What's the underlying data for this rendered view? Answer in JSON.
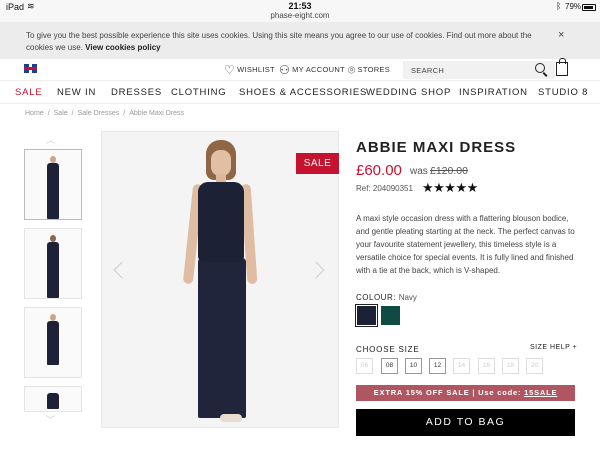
{
  "status_bar": {
    "carrier": "iPad",
    "time": "21:53",
    "url": "phase-eight.com",
    "battery": "79%"
  },
  "cookie_banner": {
    "message": "To give you the best possible experience this site uses cookies. Using this site means you agree to our use of cookies. Find out more about the cookies we use.",
    "link": "View cookies policy",
    "close": "×"
  },
  "utility_bar": {
    "wishlist": "WISHLIST",
    "account": "MY ACCOUNT",
    "stores": "STORES",
    "search_placeholder": "SEARCH"
  },
  "nav": {
    "items": [
      "SALE",
      "NEW IN",
      "DRESSES",
      "CLOTHING",
      "SHOES & ACCESSORIES",
      "WEDDING SHOP",
      "INSPIRATION",
      "STUDIO 8"
    ]
  },
  "breadcrumb": [
    "Home",
    "Sale",
    "Sale Dresses",
    "Abbie Maxi Dress"
  ],
  "product": {
    "badge": "SALE",
    "title": "ABBIE MAXI DRESS",
    "price_now": "£60.00",
    "was_label": "was",
    "price_was": "£120.00",
    "ref": "Ref: 204090351",
    "rating": 4.5,
    "rating_stars": "★★★★★",
    "description": "A maxi style occasion dress with a flattering blouson bodice, and gentle pleating starting at the neck. The perfect canvas to your favourite statement jewellery, this timeless style is a versatile choice for special events. It is fully lined and finished with a tie at the back, which is V-shaped.",
    "colour_label": "COLOUR:",
    "colour_value": "Navy",
    "colours": [
      {
        "name": "Navy",
        "hex": "#1c2136",
        "selected": true
      },
      {
        "name": "Green",
        "hex": "#0f4a44",
        "selected": false
      }
    ],
    "size_label": "CHOOSE SIZE",
    "size_help": "SIZE HELP",
    "size_help_icon": "+",
    "sizes": [
      {
        "label": "06",
        "available": false
      },
      {
        "label": "08",
        "available": true
      },
      {
        "label": "10",
        "available": true
      },
      {
        "label": "12",
        "available": true
      },
      {
        "label": "14",
        "available": false
      },
      {
        "label": "16",
        "available": false
      },
      {
        "label": "18",
        "available": false
      },
      {
        "label": "20",
        "available": false
      }
    ],
    "promo_text": "EXTRA 15% OFF SALE | Use code: ",
    "promo_code": "15SALE",
    "add_to_bag": "ADD TO BAG"
  },
  "colors": {
    "accent": "#c4122f",
    "promo": "#b05663",
    "button": "#000000"
  }
}
